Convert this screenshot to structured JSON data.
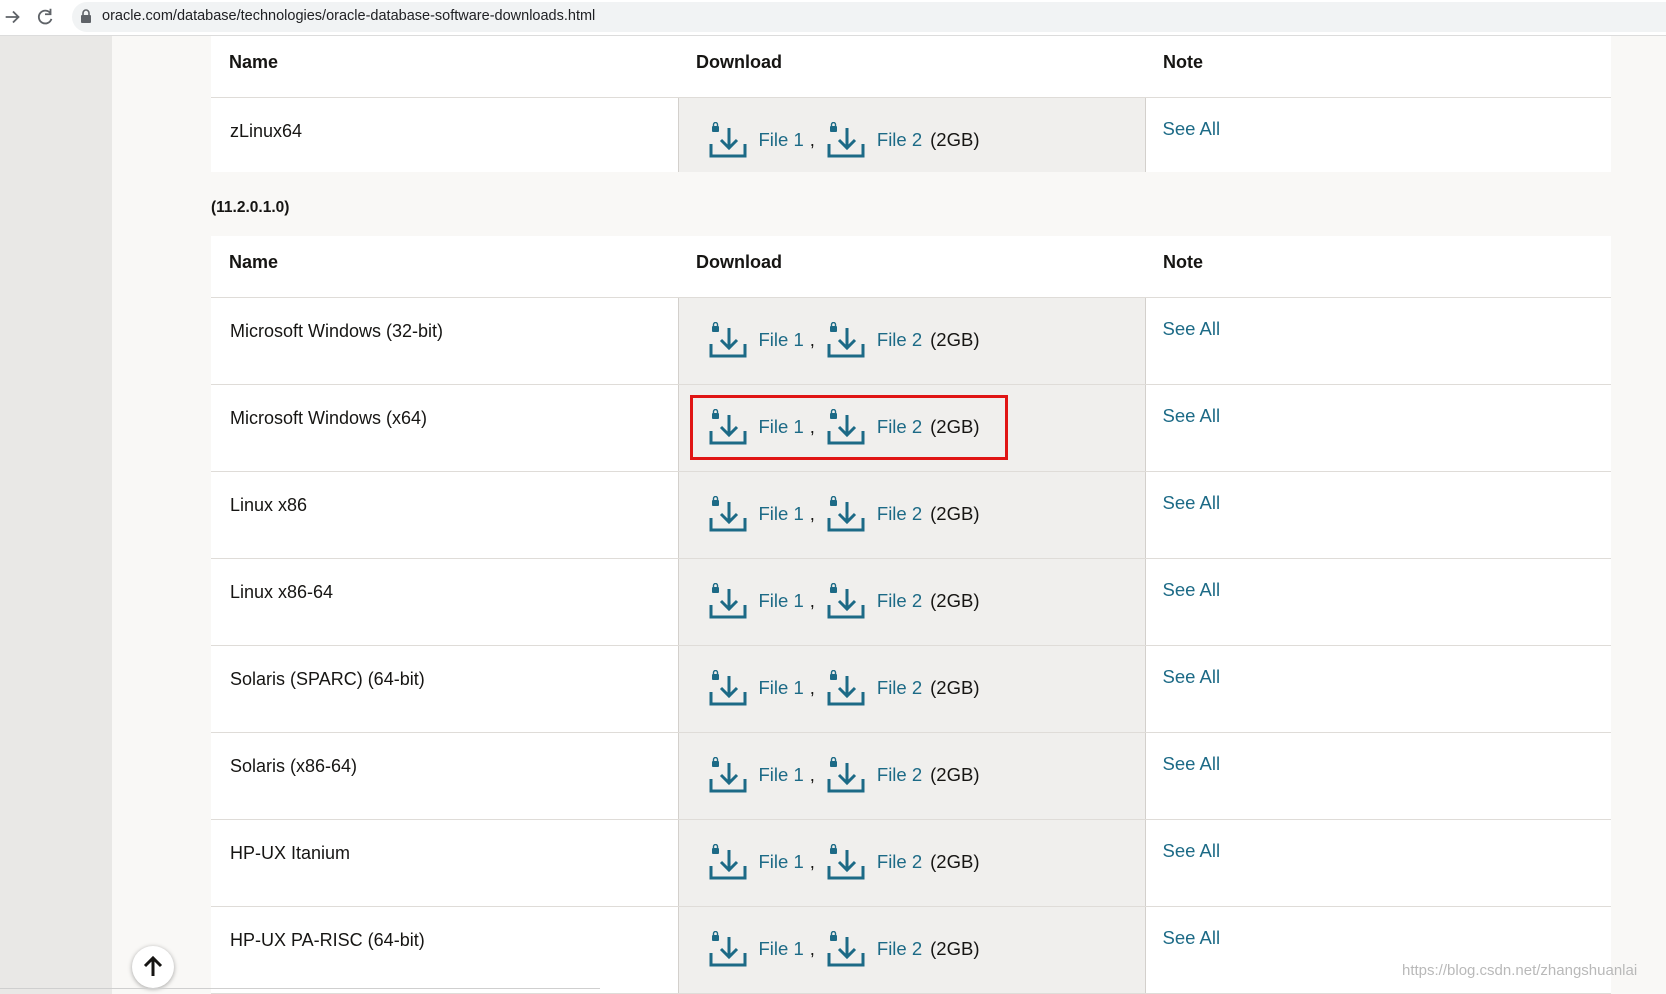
{
  "browser": {
    "url": "oracle.com/database/technologies/oracle-database-software-downloads.html"
  },
  "table1": {
    "headers": {
      "name": "Name",
      "download": "Download",
      "note": "Note"
    },
    "rows": [
      {
        "name": "zLinux64",
        "file1": "File 1",
        "file2": "File 2",
        "size": "(2GB)",
        "note": "See All"
      }
    ]
  },
  "section2": {
    "version": "(11.2.0.1.0)"
  },
  "table2": {
    "headers": {
      "name": "Name",
      "download": "Download",
      "note": "Note"
    },
    "rows": [
      {
        "name": "Microsoft Windows (32-bit)",
        "file1": "File 1",
        "file2": "File 2",
        "size": "(2GB)",
        "note": "See All"
      },
      {
        "name": "Microsoft Windows (x64)",
        "file1": "File 1",
        "file2": "File 2",
        "size": "(2GB)",
        "note": "See All"
      },
      {
        "name": "Linux x86",
        "file1": "File 1",
        "file2": "File 2",
        "size": "(2GB)",
        "note": "See All"
      },
      {
        "name": "Linux x86-64",
        "file1": "File 1",
        "file2": "File 2",
        "size": "(2GB)",
        "note": "See All"
      },
      {
        "name": "Solaris (SPARC) (64-bit)",
        "file1": "File 1",
        "file2": "File 2",
        "size": "(2GB)",
        "note": "See All"
      },
      {
        "name": "Solaris (x86-64)",
        "file1": "File 1",
        "file2": "File 2",
        "size": "(2GB)",
        "note": "See All"
      },
      {
        "name": "HP-UX Itanium",
        "file1": "File 1",
        "file2": "File 2",
        "size": "(2GB)",
        "note": "See All"
      },
      {
        "name": "HP-UX PA-RISC (64-bit)",
        "file1": "File 1",
        "file2": "File 2",
        "size": "(2GB)",
        "note": "See All"
      }
    ]
  },
  "comma": ",",
  "watermark": "https://blog.csdn.net/zhangshuanlai",
  "colors": {
    "link": "#1c6a86",
    "highlight": "#e01515"
  },
  "icons": {
    "download": "download-icon",
    "back_to_top": "arrow-up-icon",
    "lock": "lock-icon"
  }
}
